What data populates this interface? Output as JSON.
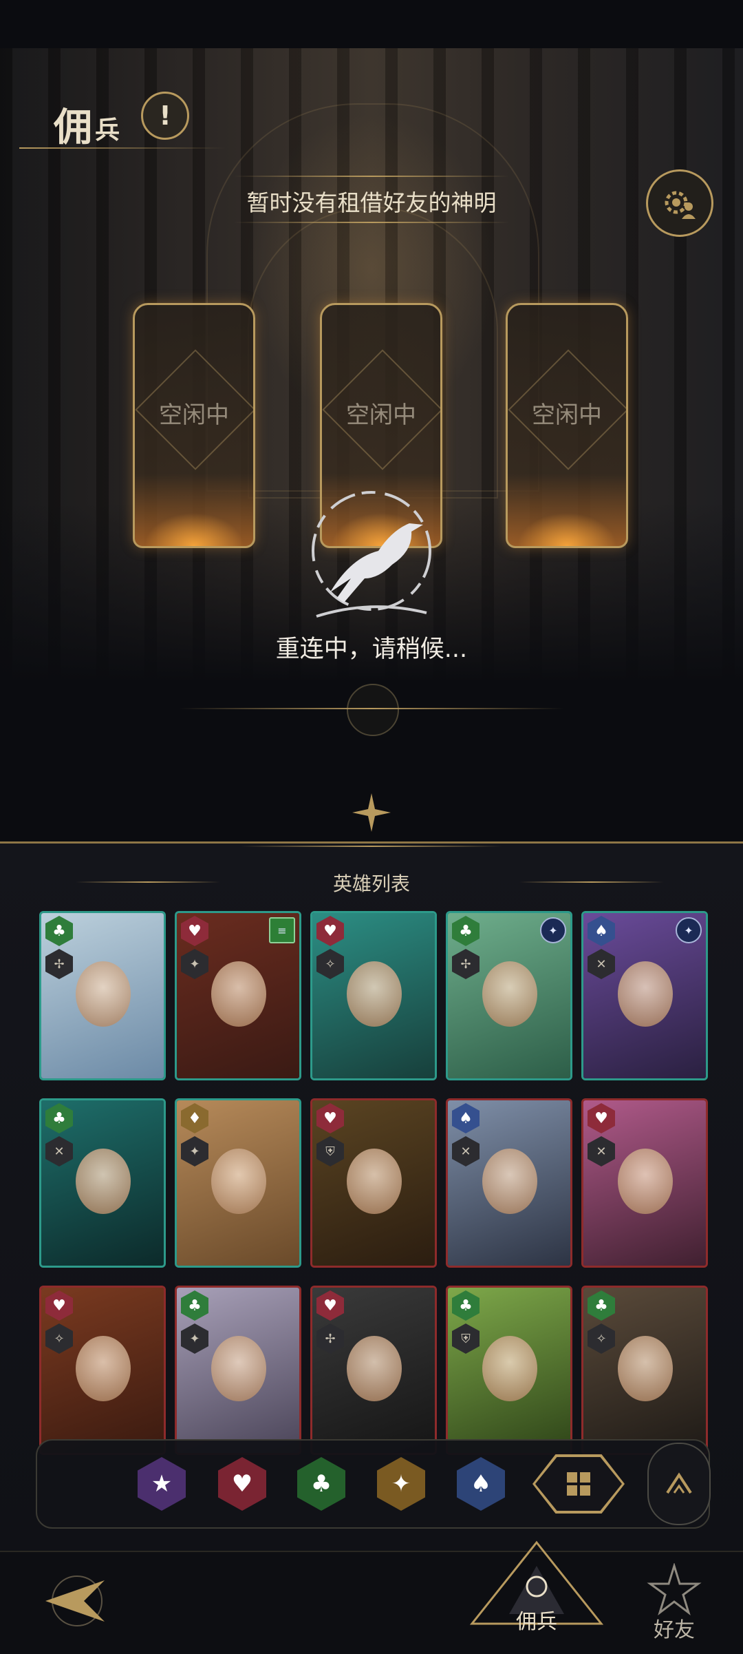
{
  "header": {
    "title_char1": "佣",
    "title_char2": "兵",
    "warning_symbol": "!"
  },
  "friend_notice": "暂时没有租借好友的神明",
  "slots": [
    {
      "label": "空闲中"
    },
    {
      "label": "空闲中"
    },
    {
      "label": "空闲中"
    }
  ],
  "reconnect_text": "重连中，请稍候...",
  "hero_list": {
    "title": "英雄列表",
    "cards": [
      {
        "suit": "club",
        "suit_glyph": "♣",
        "suit_color": "#2f7d3b",
        "role_glyph": "✢",
        "frame": "teal",
        "badge": ""
      },
      {
        "suit": "heart",
        "suit_glyph": "♥",
        "suit_color": "#8e2b3a",
        "role_glyph": "✦",
        "frame": "teal",
        "badge": "note"
      },
      {
        "suit": "heart",
        "suit_glyph": "♥",
        "suit_color": "#8e2b3a",
        "role_glyph": "✧",
        "frame": "teal",
        "badge": ""
      },
      {
        "suit": "club",
        "suit_glyph": "♣",
        "suit_color": "#2f7d3b",
        "role_glyph": "✢",
        "frame": "teal",
        "badge": "star"
      },
      {
        "suit": "spade",
        "suit_glyph": "♠",
        "suit_color": "#35508f",
        "role_glyph": "✕",
        "frame": "teal",
        "badge": "star"
      },
      {
        "suit": "club",
        "suit_glyph": "♣",
        "suit_color": "#2f7d3b",
        "role_glyph": "✕",
        "frame": "teal",
        "badge": ""
      },
      {
        "suit": "diamond",
        "suit_glyph": "♦",
        "suit_color": "#8a6a2f",
        "role_glyph": "✦",
        "frame": "teal",
        "badge": ""
      },
      {
        "suit": "heart",
        "suit_glyph": "♥",
        "suit_color": "#8e2b3a",
        "role_glyph": "⛨",
        "frame": "red",
        "badge": ""
      },
      {
        "suit": "spade",
        "suit_glyph": "♠",
        "suit_color": "#35508f",
        "role_glyph": "✕",
        "frame": "red",
        "badge": ""
      },
      {
        "suit": "heart",
        "suit_glyph": "♥",
        "suit_color": "#8e2b3a",
        "role_glyph": "✕",
        "frame": "red",
        "badge": ""
      },
      {
        "suit": "heart",
        "suit_glyph": "♥",
        "suit_color": "#8e2b3a",
        "role_glyph": "✧",
        "frame": "red",
        "badge": ""
      },
      {
        "suit": "club",
        "suit_glyph": "♣",
        "suit_color": "#2f7d3b",
        "role_glyph": "✦",
        "frame": "red",
        "badge": ""
      },
      {
        "suit": "heart",
        "suit_glyph": "♥",
        "suit_color": "#8e2b3a",
        "role_glyph": "✢",
        "frame": "red",
        "badge": ""
      },
      {
        "suit": "club",
        "suit_glyph": "♣",
        "suit_color": "#2f7d3b",
        "role_glyph": "⛨",
        "frame": "red",
        "badge": ""
      },
      {
        "suit": "club",
        "suit_glyph": "♣",
        "suit_color": "#2f7d3b",
        "role_glyph": "✧",
        "frame": "red",
        "badge": ""
      }
    ]
  },
  "filters": [
    {
      "name": "star",
      "glyph": "★",
      "color": "#4b2f6e"
    },
    {
      "name": "heart",
      "glyph": "♥",
      "color": "#7a2432"
    },
    {
      "name": "club",
      "glyph": "♣",
      "color": "#24612c"
    },
    {
      "name": "diamond",
      "glyph": "✦",
      "color": "#7a5a22"
    },
    {
      "name": "spade",
      "glyph": "♠",
      "color": "#2d4477"
    }
  ],
  "filter_all_glyph": "▦",
  "bottom_nav": {
    "mercenary_label": "佣兵",
    "friends_label": "好友"
  },
  "colors": {
    "gold": "#b89a5e",
    "panel_bg": "#14151b"
  }
}
